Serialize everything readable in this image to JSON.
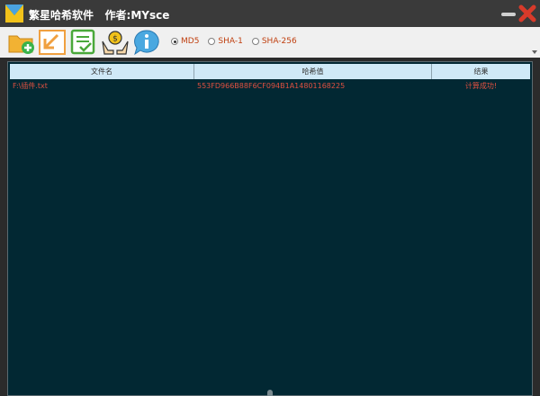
{
  "window": {
    "title": "Ϲ³ÐÇ¹þÏ£Èí¼þ   ×÷Õß:MYsce",
    "title_visible": "繁星哈希软件   作者:MYsce"
  },
  "toolbar": {
    "buttons": [
      {
        "icon": "add-folder-icon"
      },
      {
        "icon": "import-arrow-icon"
      },
      {
        "icon": "list-check-icon"
      },
      {
        "icon": "donate-hands-icon"
      },
      {
        "icon": "info-icon"
      }
    ],
    "hash_options": [
      {
        "label": "MD5",
        "checked": true
      },
      {
        "label": "SHA-1",
        "checked": false
      },
      {
        "label": "SHA-256",
        "checked": false
      }
    ]
  },
  "table": {
    "columns": [
      "文件名",
      "哈希值",
      "结果"
    ],
    "rows": [
      {
        "file": "F:\\插件.txt",
        "hash": "553FD966B88F6CF094B1A14801168225",
        "result": "计算成功!"
      }
    ]
  },
  "colors": {
    "titlebar": "#3a3a3a",
    "table_bg": "#022833",
    "header_bg": "#cfe9f7",
    "row_text": "#e05040",
    "radio_text": "#c04010",
    "close_red": "#d83a2a"
  }
}
